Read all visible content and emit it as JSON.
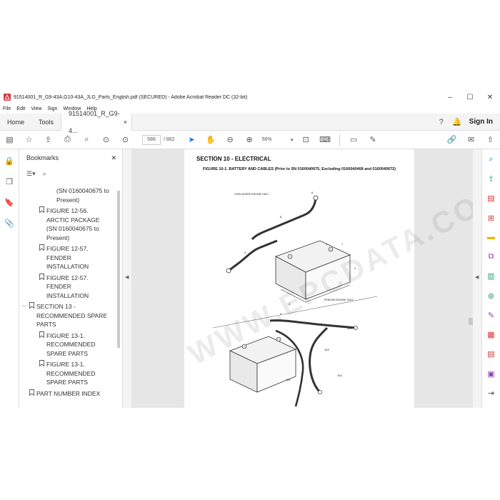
{
  "window": {
    "title": "91514001_R_G9-43A,G10-43A_JLG_Parts_English.pdf (SECURED) - Adobe Acrobat Reader DC (32-bit)",
    "minimize": "–",
    "maximize": "☐",
    "close": "✕"
  },
  "menu": [
    "File",
    "Edit",
    "View",
    "Sign",
    "Window",
    "Help"
  ],
  "tabs": {
    "home": "Home",
    "tools": "Tools",
    "doc": "91514001_R_G9-4...",
    "doc_close": "×",
    "sign_in": "Sign In"
  },
  "toolbar": {
    "page_current": "586",
    "page_total": "/  862",
    "zoom": "56%"
  },
  "bookmarks": {
    "header": "Bookmarks",
    "close": "✕",
    "items": [
      {
        "indent": 2,
        "flag": false,
        "toggle": "",
        "label": "(SN 0160040675 to\nPresent)"
      },
      {
        "indent": 1,
        "flag": true,
        "toggle": "",
        "label": "FIGURE 12-56.\nARCTIC PACKAGE\n(SN 0160040675 to\nPresent)"
      },
      {
        "indent": 1,
        "flag": true,
        "toggle": "",
        "label": "FIGURE 12-57.\nFENDER\nINSTALLATION"
      },
      {
        "indent": 1,
        "flag": true,
        "toggle": "",
        "label": "FIGURE 12-57.\nFENDER\nINSTALLATION"
      },
      {
        "indent": 0,
        "flag": true,
        "toggle": "⌵",
        "label": "SECTION 13 -\nRECOMMENDED SPARE\nPARTS"
      },
      {
        "indent": 1,
        "flag": true,
        "toggle": "",
        "label": "FIGURE 13-1.\nRECOMMENDED\nSPARE PARTS"
      },
      {
        "indent": 1,
        "flag": true,
        "toggle": "",
        "label": "FIGURE 13-1.\nRECOMMENDED\nSPARE PARTS"
      },
      {
        "indent": 0,
        "flag": true,
        "toggle": "",
        "label": "PART NUMBER INDEX"
      }
    ]
  },
  "document": {
    "section_title": "SECTION 10 - ELECTRICAL",
    "figure_title": "FIGURE 10-1. BATTERY AND CABLES (Prior to SN 0160040675, Excluding 0160040468 and 0160040672)",
    "label_john_deere": "JOHN DEERE ENGINE ONLY",
    "label_perkins": "PERKINS ENGINE ONLY",
    "callouts": [
      "1",
      "2",
      "3",
      "4",
      "5",
      "6",
      "7",
      "8",
      "100",
      "101",
      "102",
      "103",
      "104"
    ],
    "watermark": "WWW.EPCDATA.COM"
  },
  "colors": {
    "accent": "#1473e6",
    "red_icon": "#d7373f",
    "purple_icon": "#8e44ad",
    "green_icon": "#2d9d78",
    "yellow_icon": "#e6b800"
  }
}
